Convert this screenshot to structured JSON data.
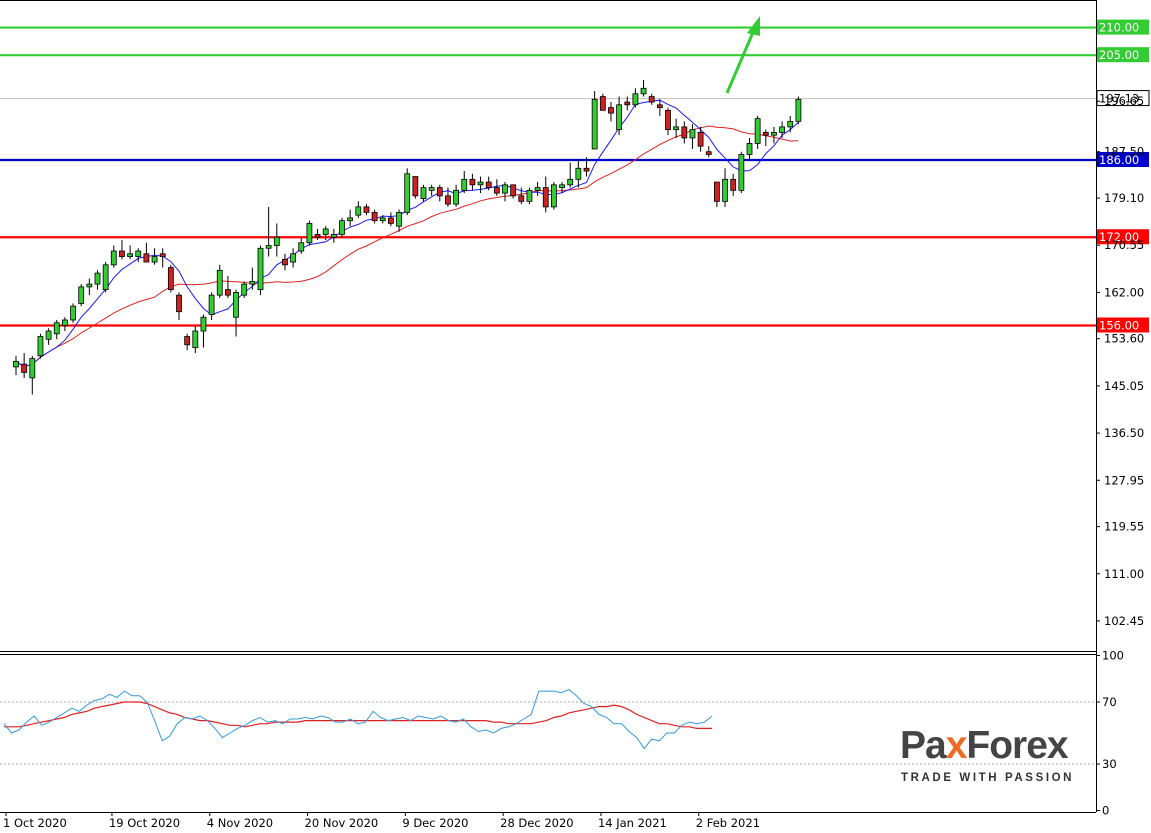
{
  "chart_data": {
    "type": "candlestick",
    "current_price": "197.13",
    "price_axis": {
      "ticks": [
        "196.65",
        "187.50",
        "179.10",
        "170.55",
        "162.00",
        "153.60",
        "145.05",
        "136.50",
        "127.95",
        "119.55",
        "111.00",
        "102.45"
      ],
      "ylim": [
        97,
        215
      ]
    },
    "x_axis": {
      "labels": [
        "1 Oct 2020",
        "19 Oct 2020",
        "4 Nov 2020",
        "20 Nov 2020",
        "9 Dec 2020",
        "28 Dec 2020",
        "14 Jan 2021",
        "2 Feb 2021"
      ],
      "label_index": [
        0,
        13,
        25,
        37,
        49,
        61,
        73,
        85
      ]
    },
    "levels": [
      {
        "value": 210,
        "label": "210.00",
        "color": "#33cc33"
      },
      {
        "value": 205,
        "label": "205.00",
        "color": "#33cc33"
      },
      {
        "value": 186,
        "label": "186.00",
        "color": "#0000cc"
      },
      {
        "value": 172,
        "label": "172.00",
        "color": "#ff0000"
      },
      {
        "value": 156,
        "label": "156.00",
        "color": "#ff0000"
      }
    ],
    "candles": [
      [
        148.5,
        150.5,
        147.0,
        149.5
      ],
      [
        149.0,
        151.0,
        146.5,
        147.5
      ],
      [
        146.5,
        150.5,
        143.5,
        150.0
      ],
      [
        150.5,
        154.5,
        150.0,
        154.0
      ],
      [
        153.5,
        155.5,
        152.5,
        155.0
      ],
      [
        154.5,
        157.0,
        153.5,
        156.5
      ],
      [
        156.0,
        157.5,
        155.0,
        157.0
      ],
      [
        157.0,
        160.0,
        156.5,
        159.5
      ],
      [
        160.0,
        163.5,
        159.5,
        163.0
      ],
      [
        163.0,
        164.5,
        161.5,
        163.5
      ],
      [
        163.5,
        166.0,
        162.5,
        165.5
      ],
      [
        162.5,
        167.5,
        162.0,
        167.0
      ],
      [
        167.0,
        170.5,
        166.5,
        169.5
      ],
      [
        169.5,
        171.5,
        168.0,
        168.5
      ],
      [
        168.5,
        170.5,
        168.0,
        169.0
      ],
      [
        168.5,
        170.0,
        167.5,
        169.5
      ],
      [
        169.0,
        171.0,
        167.5,
        167.5
      ],
      [
        167.5,
        170.0,
        167.0,
        168.5
      ],
      [
        169.0,
        170.0,
        166.5,
        168.5
      ],
      [
        166.5,
        167.0,
        162.0,
        162.5
      ],
      [
        161.5,
        162.0,
        157.0,
        158.5
      ],
      [
        154.0,
        154.5,
        151.5,
        152.5
      ],
      [
        152.0,
        156.0,
        151.0,
        155.0
      ],
      [
        155.0,
        158.0,
        152.0,
        157.5
      ],
      [
        158.0,
        162.0,
        157.0,
        161.5
      ],
      [
        161.5,
        167.0,
        161.0,
        166.0
      ],
      [
        162.5,
        165.0,
        161.0,
        161.5
      ],
      [
        157.5,
        162.5,
        154.0,
        162.0
      ],
      [
        161.5,
        164.0,
        161.0,
        163.5
      ],
      [
        163.5,
        166.5,
        162.5,
        164.0
      ],
      [
        162.5,
        170.5,
        161.5,
        170.0
      ],
      [
        170.0,
        177.5,
        168.5,
        170.5
      ],
      [
        170.5,
        174.5,
        168.5,
        172.0
      ],
      [
        168.0,
        169.0,
        166.0,
        167.0
      ],
      [
        167.5,
        170.0,
        166.5,
        169.0
      ],
      [
        169.5,
        172.0,
        169.0,
        171.0
      ],
      [
        171.0,
        175.0,
        170.5,
        174.5
      ],
      [
        172.5,
        173.5,
        171.5,
        172.0
      ],
      [
        172.5,
        174.0,
        171.5,
        173.5
      ],
      [
        172.0,
        173.5,
        171.0,
        172.5
      ],
      [
        172.5,
        175.5,
        172.0,
        175.0
      ],
      [
        175.0,
        177.0,
        174.0,
        175.5
      ],
      [
        176.0,
        178.5,
        175.5,
        177.5
      ],
      [
        177.5,
        178.0,
        176.0,
        176.5
      ],
      [
        176.5,
        177.0,
        174.5,
        175.0
      ],
      [
        175.0,
        176.0,
        174.5,
        175.5
      ],
      [
        175.5,
        176.5,
        174.0,
        174.5
      ],
      [
        174.0,
        177.0,
        173.0,
        176.5
      ],
      [
        176.5,
        184.5,
        176.0,
        183.5
      ],
      [
        183.0,
        182.5,
        179.0,
        179.5
      ],
      [
        179.0,
        181.5,
        178.5,
        181.0
      ],
      [
        180.5,
        181.5,
        179.5,
        181.0
      ],
      [
        181.0,
        181.5,
        178.5,
        179.5
      ],
      [
        179.5,
        181.0,
        177.5,
        178.0
      ],
      [
        178.0,
        181.5,
        177.5,
        180.5
      ],
      [
        180.5,
        184.0,
        180.0,
        182.5
      ],
      [
        182.5,
        183.5,
        180.5,
        181.5
      ],
      [
        181.5,
        183.0,
        180.0,
        182.0
      ],
      [
        182.0,
        183.0,
        180.5,
        181.0
      ],
      [
        181.0,
        182.5,
        179.5,
        180.0
      ],
      [
        180.0,
        182.0,
        178.5,
        181.5
      ],
      [
        181.5,
        181.5,
        179.0,
        179.5
      ],
      [
        179.5,
        181.0,
        178.0,
        178.5
      ],
      [
        178.5,
        181.0,
        178.0,
        180.5
      ],
      [
        180.5,
        182.0,
        179.5,
        181.0
      ],
      [
        181.0,
        183.0,
        176.5,
        177.5
      ],
      [
        177.5,
        182.0,
        177.0,
        181.5
      ],
      [
        181.0,
        182.0,
        180.0,
        181.5
      ],
      [
        181.5,
        185.5,
        181.0,
        182.5
      ],
      [
        182.5,
        186.0,
        181.0,
        184.5
      ],
      [
        184.5,
        186.5,
        183.0,
        184.0
      ],
      [
        188.0,
        198.5,
        188.0,
        197.0
      ],
      [
        197.5,
        198.0,
        195.0,
        195.0
      ],
      [
        195.5,
        196.5,
        193.0,
        194.5
      ],
      [
        191.5,
        197.5,
        190.5,
        196.0
      ],
      [
        196.5,
        197.5,
        195.0,
        196.0
      ],
      [
        196.0,
        199.0,
        195.5,
        198.0
      ],
      [
        198.0,
        200.5,
        197.5,
        199.0
      ],
      [
        197.5,
        198.0,
        196.0,
        196.5
      ],
      [
        196.0,
        197.0,
        194.0,
        195.5
      ],
      [
        195.0,
        195.5,
        190.5,
        191.5
      ],
      [
        191.5,
        193.5,
        190.0,
        192.0
      ],
      [
        192.0,
        193.0,
        189.0,
        190.0
      ],
      [
        190.0,
        192.5,
        188.0,
        191.5
      ],
      [
        191.0,
        192.0,
        187.5,
        188.5
      ],
      [
        187.5,
        188.5,
        186.5,
        187.0
      ],
      [
        182.0,
        181.5,
        177.5,
        178.5
      ],
      [
        178.5,
        184.5,
        177.5,
        182.5
      ],
      [
        182.5,
        183.5,
        179.5,
        180.5
      ],
      [
        180.5,
        187.5,
        180.0,
        187.0
      ],
      [
        187.0,
        190.0,
        186.0,
        189.0
      ],
      [
        189.0,
        194.0,
        188.0,
        193.5
      ],
      [
        191.0,
        191.5,
        188.5,
        190.5
      ],
      [
        190.5,
        192.0,
        189.0,
        191.0
      ],
      [
        191.0,
        193.0,
        190.0,
        192.0
      ],
      [
        192.0,
        194.0,
        191.0,
        193.0
      ],
      [
        193.0,
        197.5,
        192.5,
        197.0
      ]
    ],
    "oscillator": {
      "ticks": [
        "100",
        "70",
        "30",
        "0"
      ],
      "ylim": [
        0,
        100
      ],
      "levels": [
        70,
        30
      ],
      "fast": [
        56,
        50,
        52,
        57,
        61,
        55,
        57,
        60,
        63,
        66,
        64,
        68,
        71,
        72,
        75,
        73,
        77,
        74,
        74,
        70,
        58,
        45,
        48,
        56,
        60,
        59,
        61,
        58,
        53,
        47,
        50,
        53,
        55,
        58,
        60,
        57,
        58,
        56,
        59,
        59,
        60,
        59,
        61,
        60,
        57,
        57,
        59,
        56,
        57,
        64,
        60,
        58,
        59,
        60,
        58,
        61,
        60,
        59,
        61,
        58,
        57,
        59,
        54,
        51,
        52,
        50,
        53,
        54,
        56,
        59,
        62,
        77,
        77,
        77,
        76,
        78,
        74,
        69,
        67,
        62,
        60,
        56,
        56,
        51,
        47,
        40,
        46,
        45,
        50,
        50,
        55,
        57,
        56,
        57,
        61
      ],
      "slow": [
        54,
        54,
        54,
        55,
        56,
        57,
        58,
        59,
        60,
        62,
        63,
        64,
        66,
        67,
        68,
        69,
        70,
        70,
        70,
        69,
        67,
        65,
        63,
        62,
        60,
        59,
        58,
        58,
        57,
        56,
        55,
        55,
        54,
        55,
        56,
        56,
        57,
        57,
        57,
        57,
        58,
        58,
        58,
        58,
        58,
        58,
        58,
        58,
        58,
        58,
        58,
        58,
        58,
        58,
        58,
        58,
        58,
        58,
        58,
        58,
        58,
        58,
        58,
        58,
        58,
        57,
        57,
        56,
        56,
        56,
        56,
        57,
        58,
        60,
        61,
        63,
        64,
        65,
        66,
        67,
        67,
        68,
        67,
        65,
        62,
        60,
        58,
        56,
        56,
        55,
        54,
        54,
        53,
        53,
        53
      ]
    }
  },
  "indicators": {
    "fast_ma_color": "#1a1aff",
    "slow_ma_color": "#e02020",
    "osc_fast_color": "#3399dd",
    "osc_slow_color": "#e02020"
  },
  "colors": {
    "bull": "#33cc33",
    "bear": "#cc2222",
    "arrow": "#33cc33"
  },
  "logo": {
    "part1": "Pa",
    "x": "x",
    "part2": "Forex",
    "tagline": "TRADE WITH PASSION"
  }
}
